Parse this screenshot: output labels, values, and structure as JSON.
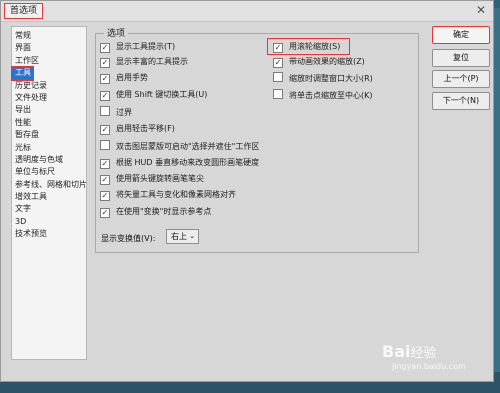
{
  "window": {
    "title": "首选项"
  },
  "sidebar": {
    "items": [
      {
        "label": "常规"
      },
      {
        "label": "界面"
      },
      {
        "label": "工作区"
      },
      {
        "label": "工具"
      },
      {
        "label": "历史记录"
      },
      {
        "label": "文件处理"
      },
      {
        "label": "导出"
      },
      {
        "label": "性能"
      },
      {
        "label": "暂存盘"
      },
      {
        "label": "光标"
      },
      {
        "label": "透明度与色域"
      },
      {
        "label": "单位与标尺"
      },
      {
        "label": "参考线、网格和切片"
      },
      {
        "label": "增效工具"
      },
      {
        "label": "文字"
      },
      {
        "label": "3D"
      },
      {
        "label": "技术预览"
      }
    ],
    "selected": "工具"
  },
  "options": {
    "group_label": "选项",
    "left": [
      {
        "label": "显示工具提示(T)",
        "checked": true
      },
      {
        "label": "显示丰富的工具提示",
        "checked": true
      },
      {
        "label": "启用手势",
        "checked": true
      },
      {
        "label": "使用 Shift 键切换工具(U)",
        "checked": true
      },
      {
        "label": "过界",
        "checked": false
      },
      {
        "label": "启用轻击平移(F)",
        "checked": true
      },
      {
        "label": "双击图层蒙版可启动\"选择并遮住\"工作区",
        "checked": false
      },
      {
        "label": "根据 HUD 垂直移动来改变圆形画笔硬度",
        "checked": true
      },
      {
        "label": "使用箭头键旋转画笔笔尖",
        "checked": true
      },
      {
        "label": "将矢量工具与变化和像素网格对齐",
        "checked": true
      },
      {
        "label": "在使用\"变换\"时显示参考点",
        "checked": true
      }
    ],
    "right": [
      {
        "label": "用滚轮缩放(S)",
        "checked": true
      },
      {
        "label": "带动画效果的缩放(Z)",
        "checked": true
      },
      {
        "label": "缩放时调整窗口大小(R)",
        "checked": false
      },
      {
        "label": "将单击点缩放至中心(K)",
        "checked": false
      }
    ],
    "transform_label": "显示变换值(V):",
    "transform_value": "右上"
  },
  "buttons": {
    "ok": "确定",
    "reset": "复位",
    "prev": "上一个(P)",
    "next": "下一个(N)"
  },
  "watermark": {
    "brand": "Bai",
    "brand2": "经验",
    "url": "jingyan.baidu.com"
  },
  "colors": {
    "selection": "#2d73c9",
    "highlight_box": "#e23b3b",
    "dialog_bg": "#d7d7d7"
  }
}
